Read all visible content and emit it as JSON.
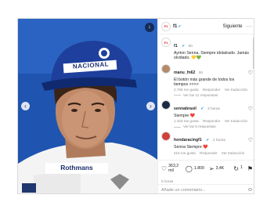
{
  "post": {
    "image": {
      "cap_text": "NACIONAL",
      "suit_text": "Rothmans",
      "bg_color": "#1f54b0"
    },
    "header": {
      "account": "f1",
      "avatar_text": "F1",
      "follow_label": "Siguiente",
      "more_icon": "more-dots-icon"
    },
    "caption": {
      "account": "f1",
      "time": "5h",
      "text": "Ayrton Senna. Siempre idolatrado. Jamás olvidado. 💛💚"
    },
    "comments": [
      {
        "user": "manu_fn62",
        "time": "5h",
        "text": "El botón más grande de todos los tiempos >>>>",
        "likes": "2.768 me gusta",
        "reply": "Responder",
        "translate": "Ver traducción",
        "replies": "Ver las 12 respuestas"
      },
      {
        "user": "sennabrasil",
        "time": "3 horas",
        "text": "Siempre ❤️",
        "likes": "1.423 me gusta",
        "reply": "Responder",
        "translate": "Ver traducción",
        "replies": "Ver las 5 respuestas"
      },
      {
        "user": "hondaracingf1",
        "time": "2 horas",
        "text": "Senna Siempre ❤️",
        "likes": "415 me gusta",
        "reply": "Responder",
        "translate": "Ver traducción"
      }
    ],
    "action_bar": {
      "likes": "363,2 mil",
      "comments": "1.809",
      "shares": "3,4K",
      "reposts": "1"
    },
    "time_ago": "5 horas",
    "composer": {
      "placeholder": "Añade un comentario..."
    }
  }
}
